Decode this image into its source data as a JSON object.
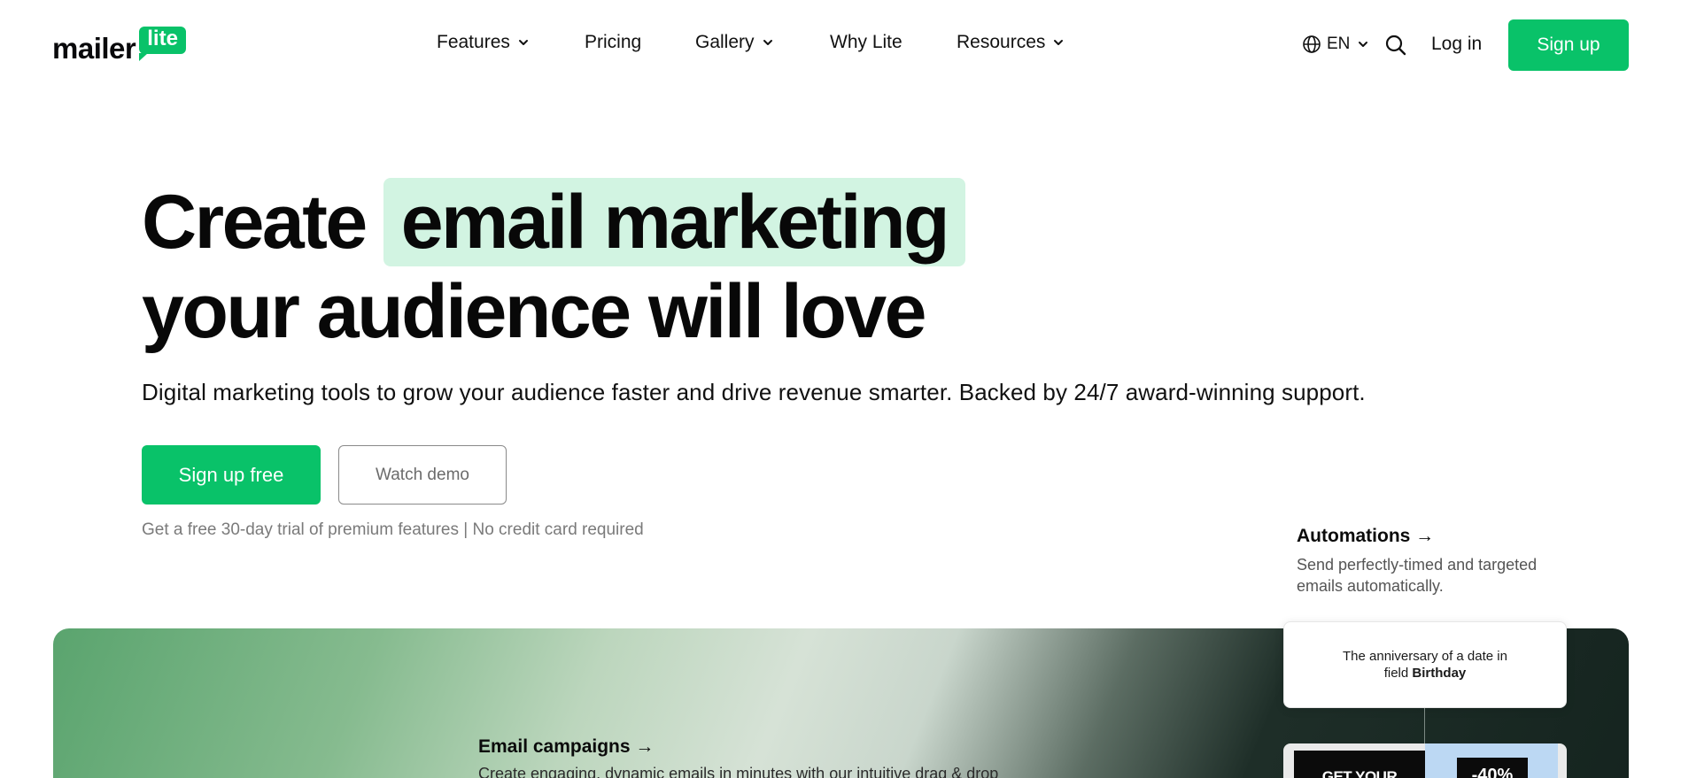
{
  "brand": {
    "logo_text": "mailer",
    "logo_badge": "lite",
    "accent_color": "#09c269",
    "highlight_color": "#d2f4e2"
  },
  "nav": {
    "items": [
      {
        "label": "Features",
        "has_dropdown": true
      },
      {
        "label": "Pricing",
        "has_dropdown": false
      },
      {
        "label": "Gallery",
        "has_dropdown": true
      },
      {
        "label": "Why Lite",
        "has_dropdown": false
      },
      {
        "label": "Resources",
        "has_dropdown": true
      }
    ],
    "language": "EN",
    "login_label": "Log in",
    "signup_label": "Sign up",
    "icons": {
      "language": "globe-icon",
      "search": "search-icon",
      "dropdown": "chevron-down-icon"
    }
  },
  "hero": {
    "title_prefix": "Create",
    "title_highlight": "email marketing",
    "title_line2": "your audience will love",
    "subtitle": "Digital marketing tools to grow your audience faster and drive revenue smarter. Backed by 24/7 award-winning support.",
    "primary_cta": "Sign up free",
    "secondary_cta": "Watch demo",
    "note": "Get a free 30-day trial of premium features | No credit card required"
  },
  "features": {
    "automations": {
      "title": "Automations →",
      "description": "Send perfectly-timed and targeted emails automatically."
    },
    "email_campaigns": {
      "title": "Email campaigns →",
      "description": "Create engaging, dynamic emails in minutes with our intuitive drag & drop"
    }
  },
  "workflow": {
    "trigger_text": "The anniversary of a date in",
    "trigger_field_prefix": "field",
    "trigger_field_name": "Birthday",
    "preview_headline": "GET YOUR",
    "preview_badge": "-40%"
  }
}
